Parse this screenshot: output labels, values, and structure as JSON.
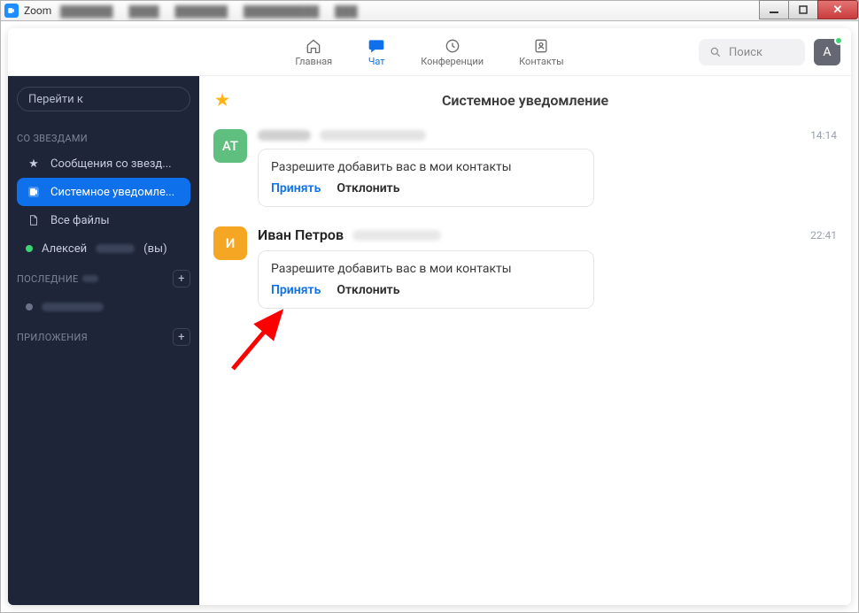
{
  "window": {
    "title": "Zoom"
  },
  "nav": {
    "home": "Главная",
    "chat": "Чат",
    "meetings": "Конференции",
    "contacts": "Контакты"
  },
  "search": {
    "placeholder": "Поиск"
  },
  "avatar": {
    "initial": "A"
  },
  "sidebar": {
    "jump_label": "Перейти к",
    "section_starred": "СО ЗВЕЗДАМИ",
    "section_recent": "ПОСЛЕДНИЕ",
    "section_apps": "ПРИЛОЖЕНИЯ",
    "items": {
      "starred_messages": "Сообщения со звезд...",
      "system_notify": "Системное уведомле...",
      "all_files": "Все файлы",
      "alexey_prefix": "Алексей",
      "alexey_suffix": "(вы)"
    }
  },
  "chat": {
    "title": "Системное уведомление",
    "messages": [
      {
        "avatar_text": "AT",
        "avatar_color": "#5fbf7f",
        "name": "",
        "time": "14:14",
        "card_text": "Разрешите добавить вас в мои контакты",
        "accept": "Принять",
        "decline": "Отклонить"
      },
      {
        "avatar_text": "И",
        "avatar_color": "#f5a623",
        "name": "Иван Петров",
        "time": "22:41",
        "card_text": "Разрешите добавить вас в мои контакты",
        "accept": "Принять",
        "decline": "Отклонить"
      }
    ]
  }
}
